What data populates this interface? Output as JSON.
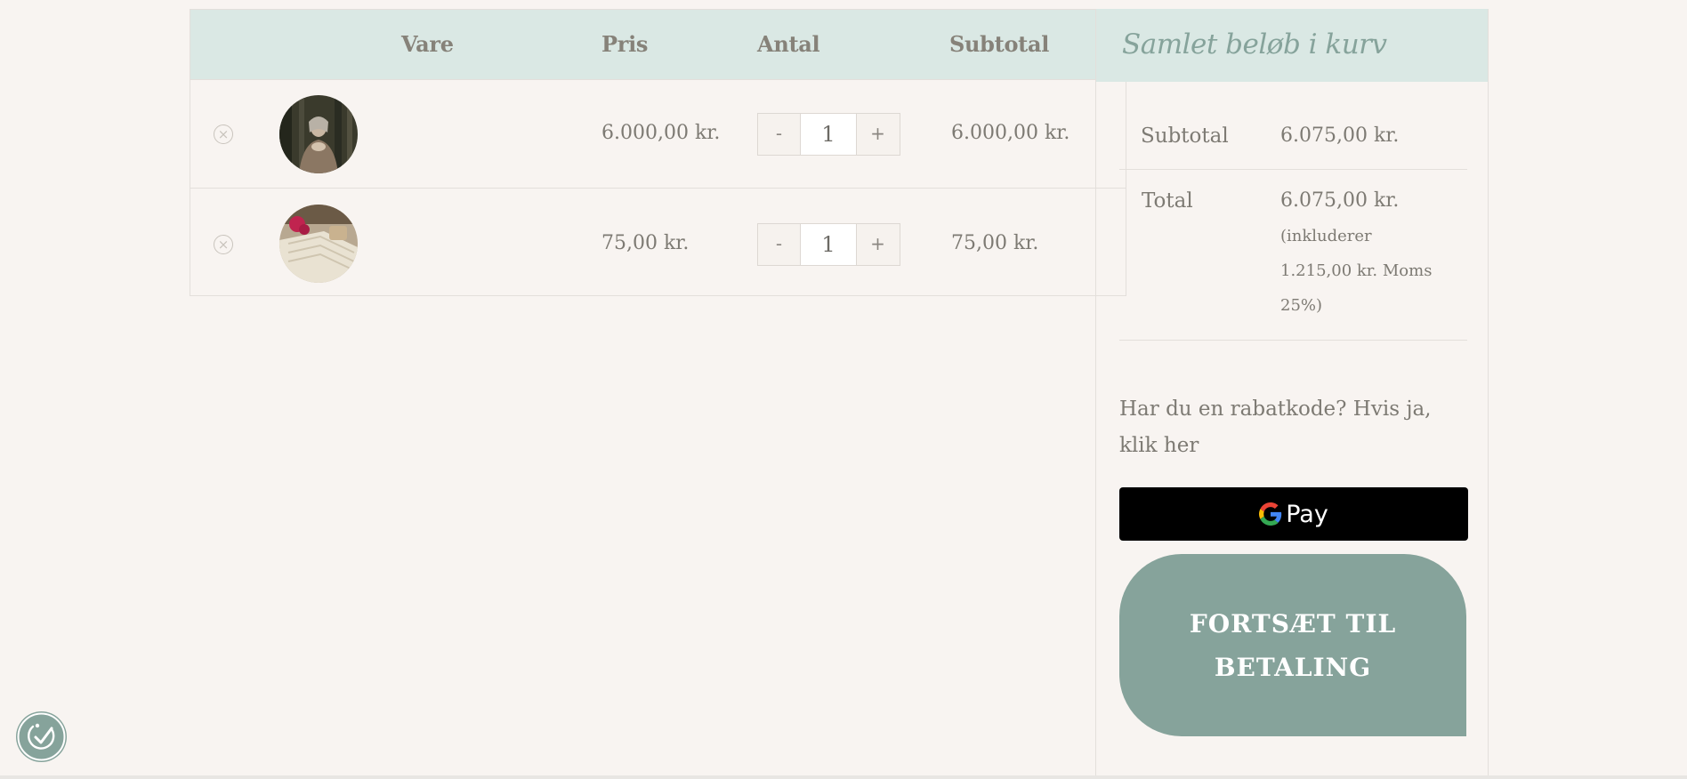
{
  "cart": {
    "headers": {
      "product": "Vare",
      "price": "Pris",
      "quantity": "Antal",
      "subtotal": "Subtotal"
    },
    "rows": [
      {
        "price": "6.000,00 kr.",
        "quantity": "1",
        "subtotal": "6.000,00 kr.",
        "thumb": "portrait-forest"
      },
      {
        "price": "75,00 kr.",
        "quantity": "1",
        "subtotal": "75,00 kr.",
        "thumb": "book-roses"
      }
    ],
    "qty_minus": "-",
    "qty_plus": "+",
    "remove_symbol": "×"
  },
  "totals": {
    "title": "Samlet beløb i kurv",
    "subtotal_label": "Subtotal",
    "subtotal_value": "6.075,00 kr.",
    "total_label": "Total",
    "total_value": "6.075,00 kr.",
    "tax_line1": "(inkluderer",
    "tax_line2": "1.215,00 kr. Moms",
    "tax_line3": "25%)",
    "coupon_text": "Har du en rabatkode? Hvis ja, klik her",
    "gpay_label": "Pay",
    "checkout_label": "FORTSÆT TIL BETALING"
  },
  "colors": {
    "accent": "#86a39b",
    "header_bg": "#dae8e4",
    "page_bg": "#f8f4f1"
  },
  "icons": {
    "remove": "close-circle-icon",
    "google": "google-g-icon",
    "accessibility": "accessibility-icon"
  }
}
